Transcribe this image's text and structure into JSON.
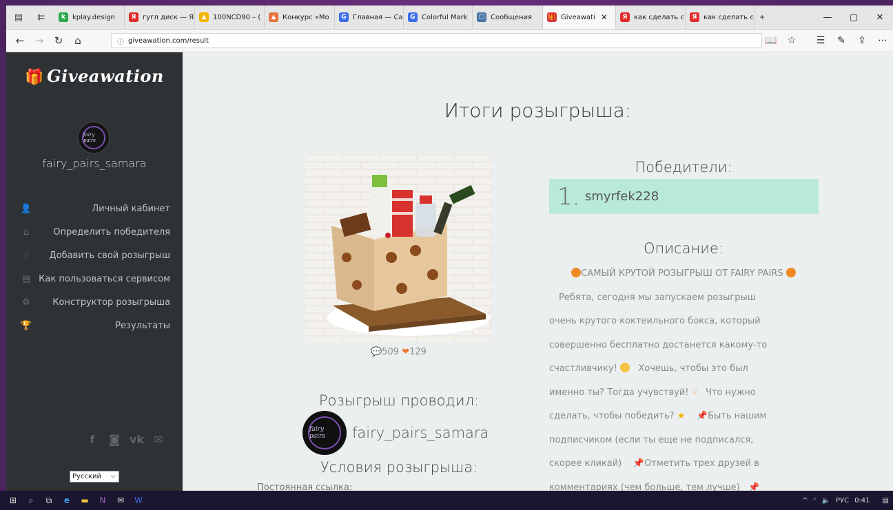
{
  "browser": {
    "tabs": [
      {
        "label": "kplay.design",
        "color": "#2aa84a",
        "glyph": "k"
      },
      {
        "label": "гугл диск — Я",
        "color": "#e22b2b",
        "glyph": "Я"
      },
      {
        "label": "100NCD90 – (",
        "color": "#f4b400",
        "glyph": "▲"
      },
      {
        "label": "Конкурс «Мо",
        "color": "#e8743b",
        "glyph": "▲"
      },
      {
        "label": "Главная — Са",
        "color": "#3b6ee8",
        "glyph": "G"
      },
      {
        "label": "Colorful Mark",
        "color": "#3b6ee8",
        "glyph": "G"
      },
      {
        "label": "Сообщения",
        "color": "#4a76a8",
        "glyph": "▢"
      },
      {
        "label": "Giveawati",
        "color": "#d23a3a",
        "glyph": "🎁",
        "active": true
      },
      {
        "label": "как сделать с",
        "color": "#e22b2b",
        "glyph": "Я"
      },
      {
        "label": "как сделать с",
        "color": "#e22b2b",
        "glyph": "Я"
      }
    ],
    "url": "giveawation.com/result"
  },
  "sidebar": {
    "logo": "Giveawation",
    "username": "fairy_pairs_samara",
    "avatar_text": "fairy pairs",
    "menu": [
      {
        "label": "Личный кабинет",
        "icon": "user-icon"
      },
      {
        "label": "Определить победителя",
        "icon": "home-icon"
      },
      {
        "label": "Добавить свой розыгрыш",
        "icon": "thumb-icon"
      },
      {
        "label": "Как пользоваться сервисом",
        "icon": "book-icon"
      },
      {
        "label": "Конструктор розыгрыша",
        "icon": "gears-icon"
      },
      {
        "label": "Результаты",
        "icon": "trophy-icon"
      }
    ],
    "social": [
      "f",
      "◙",
      "vk",
      "✉"
    ],
    "language": "Русский"
  },
  "main": {
    "title": "Итоги розыгрыша:",
    "stats": {
      "comments": "509",
      "likes": "129"
    },
    "host_heading": "Розыгрыш проводил:",
    "host_name": "fairy_pairs_samara",
    "conditions_heading": "Условия розыгрыша:",
    "permalink_label": "Постоянная ссылка:",
    "winners_heading": "Победители:",
    "winners": [
      {
        "num": "1.",
        "name": "smyrfek228"
      }
    ],
    "description_heading": "Описание:",
    "description_lines": [
      "САМЫЙ КРУТОЙ РОЗЫГРЫШ ОТ FAIRY PAIRS",
      "Ребята, сегодня мы запускаем розыгрыш",
      "очень крутого коктеильного бокса, который",
      "совершенно бесплатно достанется какому-то",
      "счастливчику!",
      "Хочешь, чтобы это был",
      "именно ты? Тогда учувствуй!",
      "Что нужно",
      "сделать, чтобы победить?",
      "Быть нашим",
      "подписчиком (если ты еще не подписался,",
      "скорее кликай)",
      "Отметить трех друзей в",
      "комментариях (чем больше, тем лучше)"
    ]
  },
  "taskbar": {
    "lang": "РУС",
    "time": "0:41"
  }
}
